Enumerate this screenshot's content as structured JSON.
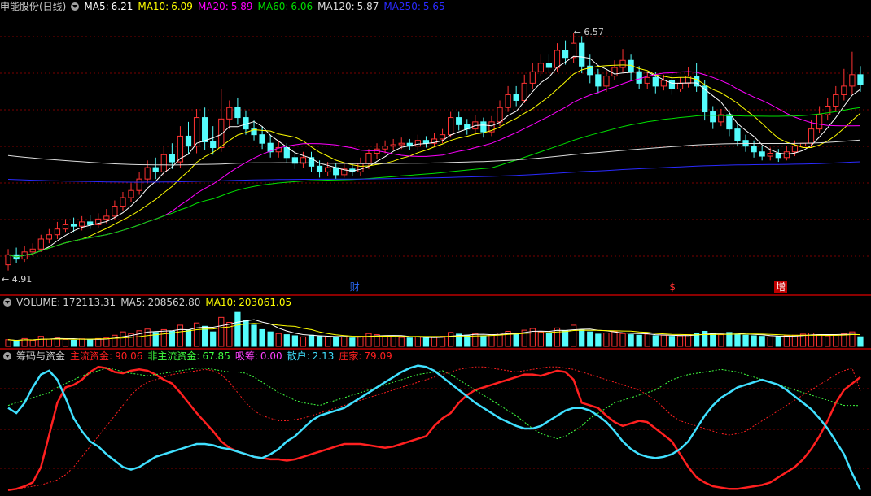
{
  "chart_data": [
    {
      "type": "line",
      "title": "申能股份(日线)",
      "legend": [
        {
          "label": "MA5:",
          "value": "6.21",
          "color": "#ffffff"
        },
        {
          "label": "MA10:",
          "value": "6.09",
          "color": "#ffff00"
        },
        {
          "label": "MA20:",
          "value": "5.89",
          "color": "#ff00ff"
        },
        {
          "label": "MA60:",
          "value": "6.06",
          "color": "#00e000"
        },
        {
          "label": "MA120:",
          "value": "5.87",
          "color": "#dcdcdc"
        },
        {
          "label": "MA250:",
          "value": "5.65",
          "color": "#2a2aff"
        }
      ],
      "high_label": "6.57",
      "low_label": "4.91",
      "ylim": [
        4.8,
        6.7
      ],
      "candles": [
        [
          4.95,
          5.02,
          5.06,
          4.91
        ],
        [
          5.02,
          4.99,
          5.07,
          4.96
        ],
        [
          4.99,
          5.04,
          5.08,
          4.97
        ],
        [
          5.04,
          5.06,
          5.1,
          5.01
        ],
        [
          5.06,
          5.13,
          5.16,
          5.04
        ],
        [
          5.13,
          5.16,
          5.2,
          5.1
        ],
        [
          5.16,
          5.2,
          5.25,
          5.13
        ],
        [
          5.2,
          5.23,
          5.27,
          5.18
        ],
        [
          5.23,
          5.22,
          5.28,
          5.18
        ],
        [
          5.22,
          5.25,
          5.29,
          5.19
        ],
        [
          5.25,
          5.23,
          5.3,
          5.2
        ],
        [
          5.23,
          5.27,
          5.31,
          5.21
        ],
        [
          5.27,
          5.29,
          5.34,
          5.24
        ],
        [
          5.29,
          5.36,
          5.4,
          5.27
        ],
        [
          5.36,
          5.42,
          5.46,
          5.33
        ],
        [
          5.42,
          5.47,
          5.52,
          5.39
        ],
        [
          5.47,
          5.55,
          5.6,
          5.44
        ],
        [
          5.55,
          5.63,
          5.68,
          5.52
        ],
        [
          5.63,
          5.6,
          5.7,
          5.55
        ],
        [
          5.6,
          5.72,
          5.78,
          5.57
        ],
        [
          5.72,
          5.67,
          5.8,
          5.62
        ],
        [
          5.67,
          5.85,
          5.92,
          5.63
        ],
        [
          5.85,
          5.78,
          5.95,
          5.72
        ],
        [
          5.78,
          5.98,
          6.04,
          5.73
        ],
        [
          5.98,
          5.81,
          6.05,
          5.75
        ],
        [
          5.81,
          5.77,
          5.92,
          5.72
        ],
        [
          5.77,
          5.97,
          6.18,
          5.74
        ],
        [
          5.97,
          6.05,
          6.1,
          5.9
        ],
        [
          6.05,
          5.98,
          6.12,
          5.93
        ],
        [
          5.98,
          5.9,
          6.03,
          5.86
        ],
        [
          5.9,
          5.86,
          5.96,
          5.82
        ],
        [
          5.86,
          5.8,
          5.92,
          5.76
        ],
        [
          5.8,
          5.74,
          5.86,
          5.7
        ],
        [
          5.74,
          5.77,
          5.82,
          5.7
        ],
        [
          5.77,
          5.7,
          5.8,
          5.66
        ],
        [
          5.7,
          5.66,
          5.74,
          5.62
        ],
        [
          5.66,
          5.7,
          5.74,
          5.63
        ],
        [
          5.7,
          5.64,
          5.74,
          5.6
        ],
        [
          5.64,
          5.6,
          5.68,
          5.56
        ],
        [
          5.6,
          5.63,
          5.67,
          5.57
        ],
        [
          5.63,
          5.58,
          5.66,
          5.55
        ],
        [
          5.58,
          5.62,
          5.66,
          5.56
        ],
        [
          5.62,
          5.6,
          5.66,
          5.57
        ],
        [
          5.6,
          5.66,
          5.7,
          5.57
        ],
        [
          5.66,
          5.73,
          5.76,
          5.62
        ],
        [
          5.73,
          5.76,
          5.8,
          5.69
        ],
        [
          5.76,
          5.78,
          5.82,
          5.73
        ],
        [
          5.78,
          5.79,
          5.83,
          5.75
        ],
        [
          5.79,
          5.8,
          5.84,
          5.76
        ],
        [
          5.8,
          5.78,
          5.83,
          5.75
        ],
        [
          5.78,
          5.82,
          5.86,
          5.75
        ],
        [
          5.82,
          5.8,
          5.85,
          5.77
        ],
        [
          5.8,
          5.83,
          5.87,
          5.78
        ],
        [
          5.83,
          5.86,
          5.9,
          5.8
        ],
        [
          5.86,
          5.98,
          6.02,
          5.84
        ],
        [
          5.98,
          5.93,
          6.02,
          5.89
        ],
        [
          5.93,
          5.9,
          5.97,
          5.86
        ],
        [
          5.9,
          5.95,
          6.0,
          5.86
        ],
        [
          5.95,
          5.88,
          5.98,
          5.84
        ],
        [
          5.88,
          5.95,
          5.99,
          5.85
        ],
        [
          5.95,
          6.05,
          6.1,
          5.92
        ],
        [
          6.05,
          6.14,
          6.2,
          6.02
        ],
        [
          6.14,
          6.1,
          6.2,
          6.06
        ],
        [
          6.1,
          6.22,
          6.28,
          6.08
        ],
        [
          6.22,
          6.3,
          6.36,
          6.18
        ],
        [
          6.3,
          6.36,
          6.42,
          6.27
        ],
        [
          6.36,
          6.33,
          6.42,
          6.29
        ],
        [
          6.33,
          6.45,
          6.5,
          6.3
        ],
        [
          6.45,
          6.4,
          6.52,
          6.35
        ],
        [
          6.4,
          6.5,
          6.57,
          6.36
        ],
        [
          6.5,
          6.34,
          6.55,
          6.29
        ],
        [
          6.34,
          6.28,
          6.42,
          6.22
        ],
        [
          6.28,
          6.2,
          6.32,
          6.15
        ],
        [
          6.2,
          6.27,
          6.31,
          6.16
        ],
        [
          6.27,
          6.33,
          6.38,
          6.24
        ],
        [
          6.33,
          6.38,
          6.46,
          6.3
        ],
        [
          6.38,
          6.3,
          6.42,
          6.24
        ],
        [
          6.3,
          6.22,
          6.34,
          6.18
        ],
        [
          6.22,
          6.26,
          6.3,
          6.18
        ],
        [
          6.26,
          6.2,
          6.3,
          6.15
        ],
        [
          6.2,
          6.24,
          6.28,
          6.17
        ],
        [
          6.24,
          6.18,
          6.28,
          6.14
        ],
        [
          6.18,
          6.22,
          6.26,
          6.16
        ],
        [
          6.22,
          6.27,
          6.33,
          6.19
        ],
        [
          6.27,
          6.2,
          6.36,
          6.16
        ],
        [
          6.2,
          6.02,
          6.24,
          5.96
        ],
        [
          6.02,
          5.95,
          6.06,
          5.9
        ],
        [
          5.95,
          6.0,
          6.04,
          5.92
        ],
        [
          6.0,
          5.9,
          6.03,
          5.85
        ],
        [
          5.9,
          5.82,
          5.94,
          5.78
        ],
        [
          5.82,
          5.78,
          5.86,
          5.74
        ],
        [
          5.78,
          5.74,
          5.82,
          5.7
        ],
        [
          5.74,
          5.71,
          5.78,
          5.68
        ],
        [
          5.71,
          5.73,
          5.77,
          5.68
        ],
        [
          5.73,
          5.7,
          5.76,
          5.67
        ],
        [
          5.7,
          5.74,
          5.78,
          5.68
        ],
        [
          5.74,
          5.78,
          5.82,
          5.71
        ],
        [
          5.78,
          5.8,
          5.86,
          5.74
        ],
        [
          5.8,
          5.9,
          5.96,
          5.77
        ],
        [
          5.9,
          6.0,
          6.06,
          5.87
        ],
        [
          6.0,
          6.06,
          6.12,
          5.96
        ],
        [
          6.06,
          6.14,
          6.2,
          6.02
        ],
        [
          6.14,
          6.2,
          6.32,
          6.1
        ],
        [
          6.2,
          6.28,
          6.44,
          6.14
        ],
        [
          6.28,
          6.21,
          6.34,
          6.16
        ]
      ]
    },
    {
      "type": "bar",
      "title": "VOLUME:",
      "legend": [
        {
          "label": "VOLUME:",
          "value": "172113.31",
          "color": "#d0d0d0"
        },
        {
          "label": "MA5:",
          "value": "208562.80",
          "color": "#d0d0d0"
        },
        {
          "label": "MA10:",
          "value": "203061.05",
          "color": "#ffff00"
        }
      ],
      "ylim": [
        0,
        700000
      ],
      "values": [
        120000,
        95000,
        140000,
        110000,
        180000,
        130000,
        150000,
        125000,
        110000,
        135000,
        120000,
        140000,
        150000,
        200000,
        260000,
        230000,
        280000,
        310000,
        250000,
        300000,
        270000,
        380000,
        290000,
        420000,
        360000,
        260000,
        520000,
        430000,
        610000,
        460000,
        380000,
        300000,
        260000,
        230000,
        210000,
        190000,
        170000,
        200000,
        180000,
        170000,
        160000,
        170000,
        150000,
        180000,
        230000,
        210000,
        190000,
        170000,
        160000,
        150000,
        170000,
        150000,
        160000,
        180000,
        250000,
        220000,
        200000,
        230000,
        190000,
        210000,
        240000,
        270000,
        230000,
        290000,
        320000,
        260000,
        240000,
        330000,
        280000,
        380000,
        300000,
        260000,
        220000,
        240000,
        270000,
        230000,
        210000,
        200000,
        220000,
        190000,
        200000,
        180000,
        190000,
        210000,
        240000,
        270000,
        230000,
        210000,
        250000,
        220000,
        200000,
        190000,
        180000,
        170000,
        180000,
        190000,
        200000,
        220000,
        240000,
        210000,
        190000,
        200000,
        230000,
        260000,
        172113
      ]
    },
    {
      "type": "line",
      "title": "筹码与资金",
      "legend": [
        {
          "label": "主流资金:",
          "value": "90.06",
          "color": "#ff2020"
        },
        {
          "label": "非主流资金:",
          "value": "67.85",
          "color": "#40ff40"
        },
        {
          "label": "吸筹:",
          "value": "0.00",
          "color": "#ff40ff"
        },
        {
          "label": "散户:",
          "value": "2.13",
          "color": "#40e0ff"
        },
        {
          "label": "庄家:",
          "value": "79.09",
          "color": "#ff2020"
        }
      ],
      "ylim": [
        0,
        100
      ],
      "series": [
        {
          "name": "主流资金",
          "color": "#ff2020",
          "values": [
            2,
            3,
            5,
            8,
            20,
            45,
            70,
            82,
            84,
            88,
            94,
            98,
            97,
            94,
            93,
            95,
            96,
            95,
            92,
            88,
            85,
            78,
            70,
            62,
            55,
            48,
            40,
            35,
            32,
            30,
            28,
            27,
            26,
            26,
            25,
            26,
            28,
            30,
            32,
            34,
            36,
            38,
            38,
            38,
            37,
            36,
            35,
            36,
            38,
            40,
            42,
            44,
            52,
            58,
            62,
            70,
            76,
            80,
            82,
            84,
            86,
            88,
            90,
            92,
            92,
            91,
            93,
            95,
            94,
            88,
            70,
            68,
            66,
            60,
            55,
            52,
            54,
            56,
            55,
            50,
            45,
            40,
            30,
            20,
            12,
            8,
            5,
            4,
            3,
            3,
            4,
            5,
            6,
            8,
            12,
            16,
            20,
            26,
            34,
            44,
            56,
            70,
            80,
            85,
            90
          ]
        },
        {
          "name": "非主流资金",
          "color": "#40ff40",
          "dash": true,
          "values": [
            68,
            70,
            72,
            74,
            76,
            78,
            82,
            85,
            88,
            91,
            93,
            95,
            97,
            96,
            94,
            93,
            92,
            91,
            92,
            93,
            94,
            95,
            96,
            97,
            97,
            96,
            95,
            94,
            94,
            93,
            90,
            86,
            82,
            78,
            75,
            72,
            70,
            69,
            68,
            70,
            72,
            74,
            76,
            78,
            80,
            82,
            84,
            86,
            88,
            90,
            92,
            93,
            94,
            95,
            92,
            88,
            84,
            80,
            76,
            72,
            68,
            64,
            60,
            55,
            50,
            46,
            44,
            42,
            44,
            48,
            52,
            58,
            62,
            66,
            70,
            72,
            74,
            76,
            78,
            80,
            84,
            88,
            90,
            92,
            93,
            94,
            95,
            96,
            95,
            94,
            92,
            90,
            88,
            86,
            84,
            82,
            80,
            78,
            76,
            74,
            72,
            70,
            68,
            68,
            67.85
          ]
        },
        {
          "name": "庄家",
          "color": "#ff2020",
          "dash": true,
          "values": [
            2,
            3,
            4,
            5,
            6,
            8,
            10,
            14,
            20,
            28,
            36,
            44,
            52,
            60,
            68,
            76,
            82,
            86,
            88,
            90,
            92,
            93,
            94,
            95,
            96,
            95,
            92,
            86,
            78,
            70,
            64,
            60,
            58,
            56,
            56,
            57,
            58,
            60,
            62,
            64,
            66,
            68,
            70,
            72,
            74,
            76,
            78,
            80,
            82,
            84,
            86,
            88,
            90,
            92,
            94,
            96,
            97,
            98,
            98,
            97,
            96,
            95,
            94,
            95,
            96,
            97,
            98,
            98,
            97,
            96,
            94,
            92,
            90,
            88,
            86,
            84,
            82,
            80,
            76,
            72,
            66,
            60,
            56,
            54,
            52,
            50,
            48,
            46,
            45,
            46,
            48,
            52,
            56,
            60,
            64,
            68,
            72,
            76,
            80,
            84,
            88,
            92,
            95,
            97,
            79.09
          ]
        },
        {
          "name": "散户",
          "color": "#40e0ff",
          "values": [
            66,
            62,
            70,
            82,
            92,
            95,
            88,
            74,
            58,
            48,
            40,
            36,
            30,
            25,
            20,
            18,
            20,
            24,
            28,
            30,
            32,
            34,
            36,
            38,
            38,
            37,
            35,
            34,
            32,
            30,
            28,
            27,
            30,
            34,
            40,
            44,
            50,
            56,
            60,
            62,
            64,
            66,
            70,
            74,
            78,
            82,
            86,
            90,
            94,
            97,
            99,
            98,
            95,
            90,
            85,
            80,
            75,
            70,
            66,
            62,
            58,
            55,
            52,
            50,
            50,
            52,
            56,
            60,
            64,
            66,
            66,
            64,
            60,
            55,
            48,
            40,
            34,
            30,
            28,
            27,
            28,
            30,
            34,
            40,
            50,
            60,
            68,
            74,
            78,
            82,
            84,
            86,
            88,
            86,
            84,
            80,
            75,
            70,
            65,
            58,
            50,
            40,
            30,
            15,
            2.13
          ]
        }
      ]
    }
  ],
  "markers": [
    {
      "text": "财",
      "color": "#2a6cff",
      "bg": "transparent"
    },
    {
      "text": "$",
      "color": "#ff3030",
      "bg": "transparent"
    },
    {
      "text": "增",
      "color": "#ffffff",
      "bg": "#c00000"
    }
  ]
}
